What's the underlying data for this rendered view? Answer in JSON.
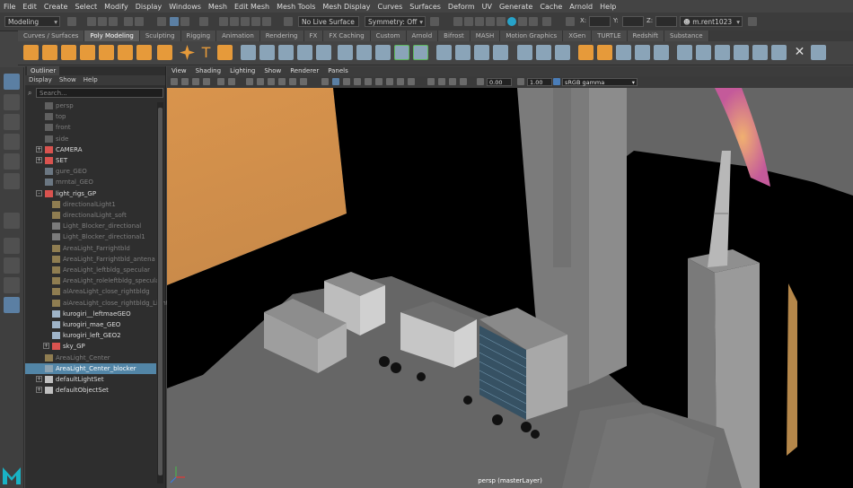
{
  "menubar": [
    "File",
    "Edit",
    "Create",
    "Select",
    "Modify",
    "Display",
    "Windows",
    "Mesh",
    "Edit Mesh",
    "Mesh Tools",
    "Mesh Display",
    "Curves",
    "Surfaces",
    "Deform",
    "UV",
    "Generate",
    "Cache",
    "Arnold",
    "Help"
  ],
  "status": {
    "mode": "Modeling",
    "live_surface": "No Live Surface",
    "symmetry": "Symmetry: Off",
    "x_label": "X:",
    "y_label": "Y:",
    "z_label": "Z:",
    "account": "m.rent1023"
  },
  "shelf_tabs": [
    "Curves / Surfaces",
    "Poly Modeling",
    "Sculpting",
    "Rigging",
    "Animation",
    "Rendering",
    "FX",
    "FX Caching",
    "Custom",
    "Arnold",
    "Bifrost",
    "MASH",
    "Motion Graphics",
    "XGen",
    "TURTLE",
    "Redshift",
    "Substance"
  ],
  "shelf_active": "Poly Modeling",
  "outliner": {
    "tab": "Outliner",
    "menu": [
      "Display",
      "Show",
      "Help"
    ],
    "search_placeholder": "Search...",
    "rows": [
      {
        "label": "persp",
        "indent": 1,
        "icon": "camera-icon",
        "dim": true,
        "exp": ""
      },
      {
        "label": "top",
        "indent": 1,
        "icon": "camera-icon",
        "dim": true,
        "exp": ""
      },
      {
        "label": "front",
        "indent": 1,
        "icon": "camera-icon",
        "dim": true,
        "exp": ""
      },
      {
        "label": "side",
        "indent": 1,
        "icon": "camera-icon",
        "dim": true,
        "exp": ""
      },
      {
        "label": "CAMERA",
        "indent": 1,
        "icon": "group-icon",
        "dim": false,
        "exp": "+"
      },
      {
        "label": "SET",
        "indent": 1,
        "icon": "group-icon",
        "dim": false,
        "exp": "+"
      },
      {
        "label": "gure_GEO",
        "indent": 1,
        "icon": "mesh-icon",
        "dim": true,
        "exp": ""
      },
      {
        "label": "mrntal_GEO",
        "indent": 1,
        "icon": "mesh-icon",
        "dim": true,
        "exp": ""
      },
      {
        "label": "light_rigs_GP",
        "indent": 1,
        "icon": "group-icon",
        "dim": false,
        "exp": "-"
      },
      {
        "label": "directionalLight1",
        "indent": 2,
        "icon": "light-icon",
        "dim": true,
        "exp": ""
      },
      {
        "label": "directionalLight_soft",
        "indent": 2,
        "icon": "light-icon",
        "dim": true,
        "exp": ""
      },
      {
        "label": "Light_Blocker_directional",
        "indent": 2,
        "icon": "blocker-icon",
        "dim": true,
        "exp": ""
      },
      {
        "label": "Light_Blocker_directional1",
        "indent": 2,
        "icon": "blocker-icon",
        "dim": true,
        "exp": ""
      },
      {
        "label": "AreaLight_Farrightbld",
        "indent": 2,
        "icon": "area-light-icon",
        "dim": true,
        "exp": ""
      },
      {
        "label": "AreaLight_Farrightbld_antena",
        "indent": 2,
        "icon": "area-light-icon",
        "dim": true,
        "exp": ""
      },
      {
        "label": "AreaLight_leftbldg_specular",
        "indent": 2,
        "icon": "area-light-icon",
        "dim": true,
        "exp": ""
      },
      {
        "label": "AreaLight_roleleftbldg_specular",
        "indent": 2,
        "icon": "area-light-icon",
        "dim": true,
        "exp": ""
      },
      {
        "label": "alAreaLight_close_rightbldg",
        "indent": 2,
        "icon": "area-light-icon",
        "dim": true,
        "exp": ""
      },
      {
        "label": "aiAreaLight_close_rightbldg_Light_Blocker",
        "indent": 2,
        "icon": "area-light-icon",
        "dim": true,
        "exp": ""
      },
      {
        "label": "kurogiri__leftmaeGEO",
        "indent": 2,
        "icon": "mesh-icon",
        "dim": false,
        "exp": ""
      },
      {
        "label": "kurogiri_mae_GEO",
        "indent": 2,
        "icon": "mesh-icon",
        "dim": false,
        "exp": ""
      },
      {
        "label": "kurogiri_left_GEO2",
        "indent": 2,
        "icon": "mesh-icon",
        "dim": false,
        "exp": ""
      },
      {
        "label": "sky_GP",
        "indent": 2,
        "icon": "group-icon",
        "dim": false,
        "exp": "+"
      },
      {
        "label": "AreaLight_Center",
        "indent": 1,
        "icon": "area-light-icon",
        "dim": true,
        "exp": ""
      },
      {
        "label": "AreaLight_Center_blocker",
        "indent": 1,
        "icon": "blocker-icon",
        "dim": true,
        "exp": "",
        "sel": true
      },
      {
        "label": "defaultLightSet",
        "indent": 1,
        "icon": "set-icon",
        "dim": false,
        "exp": "+"
      },
      {
        "label": "defaultObjectSet",
        "indent": 1,
        "icon": "set-icon",
        "dim": false,
        "exp": "+"
      }
    ]
  },
  "viewport_menu": [
    "View",
    "Shading",
    "Lighting",
    "Show",
    "Renderer",
    "Panels"
  ],
  "viewport_toolbar": {
    "near_value": "0.00",
    "gamma_value": "1.00",
    "color_space": "sRGB gamma"
  },
  "viewport_label": "persp (masterLayer)",
  "colors": {
    "accent": "#5285a6",
    "sky": "#e0a25f",
    "black": "#000000",
    "ground": "#656565"
  }
}
